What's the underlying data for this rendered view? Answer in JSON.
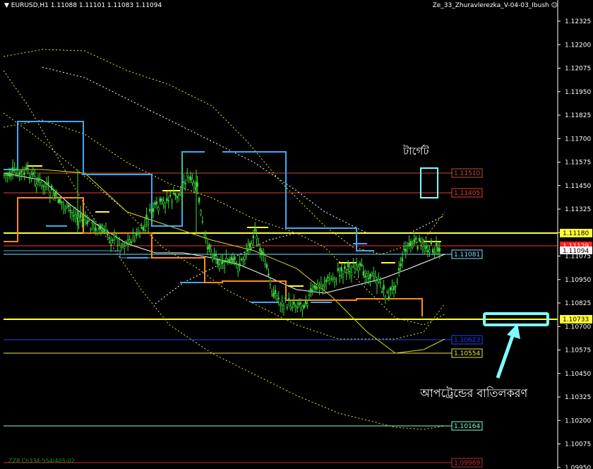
{
  "header": {
    "symbol_line": "EURUSD,H1  1.11088 1.11101 1.11083 1.11094",
    "indicator_name": "Ze_33_Zhuravlerezka_V-04-03_Ibush"
  },
  "footer_text": "ZZ8 Ch334-5S4/405-02",
  "annotations": {
    "target": "টার্গেট",
    "uptrend_cancel": "আপট্রেন্ডের বাতিলকরণ"
  },
  "colors": {
    "background": "#000000",
    "candle": "#3dd93d",
    "blue_channel": "#3fa9f5",
    "orange_channel": "#ff8c1a",
    "yellow_level": "#ffff33",
    "red_level": "#c0392b",
    "navy_level": "#1f3fff",
    "cyan_level": "#7fffd4",
    "annotation": "#7fffff"
  },
  "price_axis": {
    "ticks": [
      "1.12325",
      "1.12200",
      "1.12075",
      "1.11950",
      "1.11825",
      "1.11700",
      "1.11575",
      "1.11450",
      "1.11325",
      "1.11200",
      "1.11075",
      "1.10950",
      "1.10825",
      "1.10700",
      "1.10575",
      "1.10450",
      "1.10325",
      "1.10200",
      "1.10075",
      "1.09950"
    ],
    "current_price": "1.11094",
    "red_tag": "1.11129"
  },
  "levels": [
    {
      "label": "1.11510",
      "color": "#c05030",
      "style": "thin"
    },
    {
      "label": "1.11405",
      "color": "#e04030",
      "style": "thin"
    },
    {
      "label": "1.11180",
      "color": "#ffff33",
      "style": "thick"
    },
    {
      "label": "1.11081",
      "color": "#7fdfff",
      "style": "thin"
    },
    {
      "label": "1.10733",
      "color": "#ffff33",
      "style": "thick"
    },
    {
      "label": "1.10623",
      "color": "#2040ff",
      "style": "thin"
    },
    {
      "label": "1.10554",
      "color": "#e8e840",
      "style": "thin"
    },
    {
      "label": "1.10164",
      "color": "#7fffd4",
      "style": "thin"
    },
    {
      "label": "1.09969",
      "color": "#c03030",
      "style": "thin"
    }
  ],
  "chart_data": {
    "type": "line",
    "title": "",
    "ylim": [
      1.0992,
      1.124
    ],
    "note_series": [
      {
        "values": [
          1.1155,
          1.1172,
          1.115,
          1.1148,
          1.1144,
          1.114,
          1.1134,
          1.1121,
          1.111,
          1.1116,
          1.112,
          1.1125,
          1.1135,
          1.1125,
          1.111,
          1.1095,
          1.1106,
          1.108,
          1.109,
          1.1098,
          1.1104,
          1.1102,
          1.1096,
          1.1086,
          1.108,
          1.1083,
          1.1094,
          1.1094
        ]
      },
      {
        "values": [
          1.118,
          1.118,
          1.118,
          1.115,
          1.115,
          1.115,
          1.115,
          1.115,
          1.115,
          1.1163,
          1.1163,
          1.1163,
          1.1163,
          1.1163,
          1.1163,
          1.1118,
          1.1118,
          1.1118,
          1.1118,
          1.1118,
          1.1118,
          1.1118,
          1.1108,
          1.1108,
          1.1108,
          1.1108,
          1.1108,
          1.1108
        ]
      },
      {
        "values": [
          1.1145,
          1.1145,
          1.1145,
          1.1105,
          1.1105,
          1.1105,
          1.1105,
          1.1105,
          1.1105,
          1.1105,
          1.1105,
          1.1088,
          1.1088,
          1.1088,
          1.1088,
          1.1088,
          1.1088,
          1.1076,
          1.1076,
          1.1076,
          1.1076,
          1.1083,
          1.1083,
          1.1083,
          1.1083,
          1.1083,
          1.1083,
          1.1083
        ]
      }
    ]
  }
}
